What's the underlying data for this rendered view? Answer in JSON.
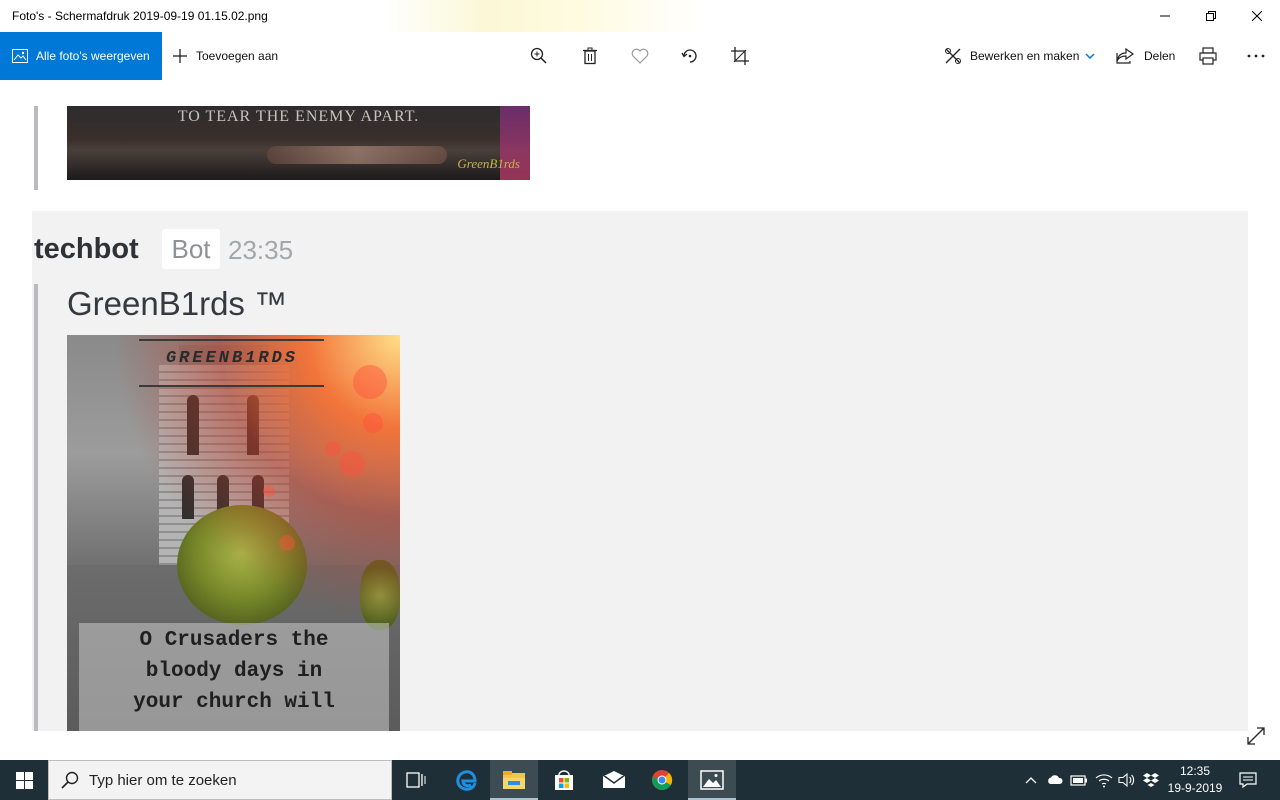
{
  "window": {
    "title": "Foto's - Schermafdruk 2019-09-19 01.15.02.png"
  },
  "toolbar": {
    "all_photos_label": "Alle foto's weergeven",
    "add_to_label": "Toevoegen aan",
    "edit_create_label": "Bewerken en maken",
    "share_label": "Delen",
    "accent_color": "#0078d7",
    "icons": [
      "zoom-icon",
      "delete-icon",
      "favorite-icon",
      "rotate-icon",
      "crop-icon",
      "edit-create-icon",
      "share-icon",
      "print-icon",
      "more-icon"
    ]
  },
  "photo": {
    "top_embed": {
      "caption": "TO TEAR THE ENEMY APART.",
      "signature": "GreenB1rds"
    },
    "message": {
      "author": "techbot",
      "badge": "Bot",
      "time": "23:35",
      "embed_title": "GreenB1rds ™",
      "image_logo": "GREENB1RDS",
      "image_quote": "O Crusaders the\nbloody days in\nyour church will"
    }
  },
  "taskbar": {
    "search_placeholder": "Typ hier om te zoeken",
    "clock_time": "12:35",
    "clock_date": "19-9-2019",
    "background_color": "#1f2f38"
  }
}
